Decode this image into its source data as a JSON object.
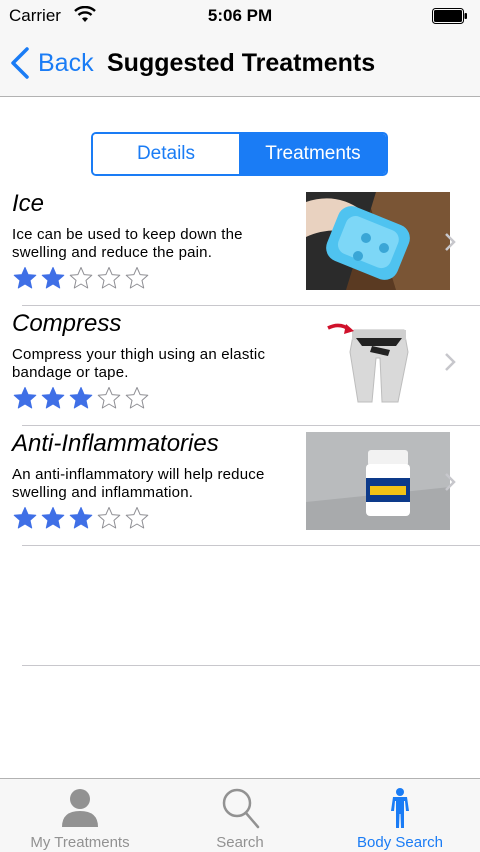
{
  "status_bar": {
    "carrier": "Carrier",
    "time": "5:06 PM"
  },
  "nav": {
    "back_label": "Back",
    "title": "Suggested Treatments"
  },
  "segments": [
    {
      "label": "Details",
      "selected": false
    },
    {
      "label": "Treatments",
      "selected": true
    }
  ],
  "treatments": [
    {
      "title": "Ice",
      "description": "Ice can be used to keep down the swelling and reduce the pain.",
      "rating": 2,
      "max_rating": 5
    },
    {
      "title": "Compress",
      "description": "Compress your thigh using an elastic bandage or tape.",
      "rating": 3,
      "max_rating": 5
    },
    {
      "title": "Anti-Inflammatories",
      "description": "An anti-inflammatory will help reduce swelling and inflammation.",
      "rating": 3,
      "max_rating": 5
    }
  ],
  "tab_bar": {
    "items": [
      {
        "label": "My Treatments",
        "icon": "person-icon",
        "selected": false
      },
      {
        "label": "Search",
        "icon": "magnifier-icon",
        "selected": false
      },
      {
        "label": "Body Search",
        "icon": "body-figure-icon",
        "selected": true
      }
    ]
  },
  "colors": {
    "accent": "#1a7cf5",
    "star_filled": "#3f6fe6",
    "star_empty_outline": "#8e8e93",
    "inactive_tab": "#929292"
  }
}
